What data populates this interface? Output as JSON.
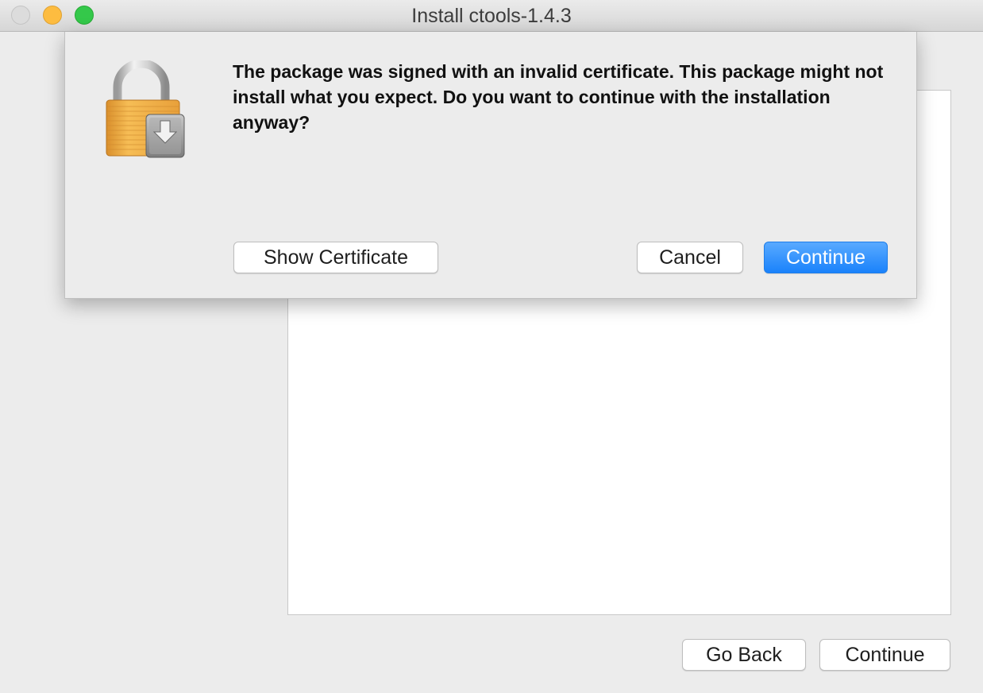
{
  "window": {
    "title": "Install ctools-1.4.3"
  },
  "dialog": {
    "icon": "locked-package-icon",
    "message": "The package was signed with an invalid certificate. This package might not install what you expect. Do you want to continue with the installation anyway?",
    "show_certificate_label": "Show Certificate",
    "cancel_label": "Cancel",
    "continue_label": "Continue"
  },
  "footer": {
    "go_back_label": "Go Back",
    "continue_label": "Continue"
  },
  "colors": {
    "primary_button": "#1a82fb",
    "close_light": "#dcdcdc",
    "minimize_light": "#fdbc40",
    "zoom_light": "#34c84a"
  }
}
